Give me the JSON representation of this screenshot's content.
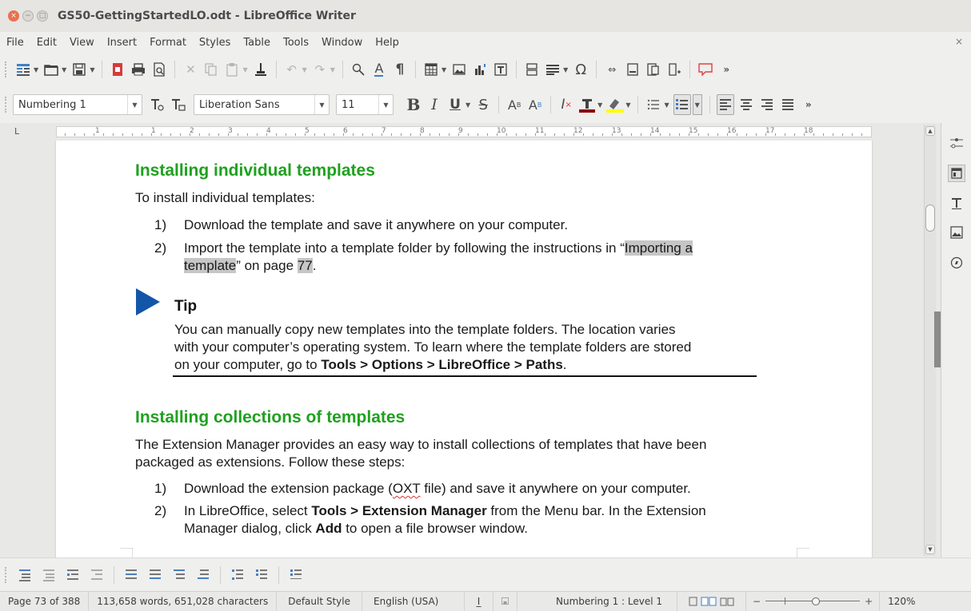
{
  "window": {
    "title": "GS50-GettingStartedLO.odt - LibreOffice Writer",
    "close_glyph": "×",
    "min_glyph": "−",
    "max_glyph": "□"
  },
  "menu": {
    "items": [
      "File",
      "Edit",
      "View",
      "Insert",
      "Format",
      "Styles",
      "Table",
      "Tools",
      "Window",
      "Help"
    ],
    "close_glyph": "×"
  },
  "formatting": {
    "paragraph_style": "Numbering 1",
    "font_name": "Liberation Sans",
    "font_size": "11",
    "bold_glyph": "B",
    "italic_glyph": "I",
    "underline_glyph": "U",
    "strike_glyph": "S",
    "superscript_glyph": "A",
    "subscript_glyph": "A",
    "clear_glyph": "I"
  },
  "ruler": {
    "corner_glyph": "L",
    "numbers": [
      "1",
      "1",
      "2",
      "3",
      "4",
      "5",
      "6",
      "7",
      "8",
      "9",
      "10",
      "11",
      "12",
      "13",
      "14",
      "15",
      "16",
      "17",
      "18"
    ]
  },
  "document": {
    "h1": "Installing individual templates",
    "p1": "To install individual templates:",
    "list1": [
      {
        "num": "1)",
        "text": "Download the template and save it anywhere on your computer."
      },
      {
        "num": "2)",
        "text_a": "Import the template into a template folder by following the instructions in “",
        "link": "Importing a",
        "link2": "template",
        "text_b": "” on page ",
        "page": "77",
        "text_c": "."
      }
    ],
    "tip": {
      "title": "Tip",
      "line1": "You can manually copy new templates into the template folders. The location varies",
      "line2": "with your computer’s operating system. To learn where the template folders are stored",
      "line3_a": "on your computer, go to ",
      "line3_bold": "Tools > Options > LibreOffice > Paths",
      "line3_b": "."
    },
    "h2": "Installing collections of templates",
    "p2_line1": "The Extension Manager provides an easy way to install collections of templates that have been",
    "p2_line2": "packaged as extensions. Follow these steps:",
    "list2": [
      {
        "num": "1)",
        "text_a": "Download the extension package (",
        "oxt": "OXT",
        "text_b": " file) and save it anywhere on your computer."
      },
      {
        "num": "2)",
        "text_a": "In LibreOffice, select ",
        "bold": "Tools > Extension Manager",
        "text_b": " from the Menu bar. In the Extension",
        "line2_a": "Manager dialog, click ",
        "line2_bold": "Add",
        "line2_b": " to open a file browser window."
      }
    ]
  },
  "status": {
    "page": "Page 73 of 388",
    "words": "113,658 words, 651,028 characters",
    "page_style": "Default Style",
    "language": "English (USA)",
    "list_level": "Numbering 1 : Level 1",
    "zoom_minus": "−",
    "zoom_plus": "+",
    "zoom": "120%"
  },
  "colors": {
    "heading": "#1fa11f",
    "tip_arrow": "#1356a8",
    "highlight": "#c6c6c6",
    "close_button": "#e9714f"
  }
}
